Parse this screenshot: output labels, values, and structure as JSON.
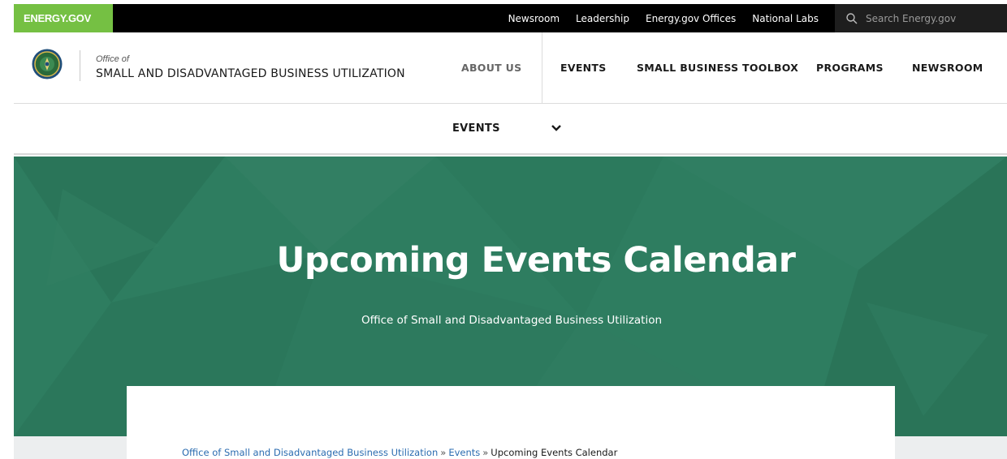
{
  "utility_bar": {
    "brand": "ENERGY.GOV",
    "links": [
      "Newsroom",
      "Leadership",
      "Energy.gov Offices",
      "National Labs"
    ],
    "search_placeholder": "Search Energy.gov"
  },
  "header": {
    "office_of": "Office of",
    "office_name": "SMALL AND DISADVANTAGED BUSINESS UTILIZATION",
    "nav": {
      "about": "ABOUT US",
      "events": "EVENTS",
      "toolbox": "SMALL BUSINESS TOOLBOX",
      "programs": "PROGRAMS",
      "newsroom": "NEWSROOM"
    }
  },
  "sub_nav": {
    "label": "EVENTS",
    "icon": "chevron-down-icon"
  },
  "hero": {
    "title": "Upcoming Events Calendar",
    "subtitle": "Office of Small and Disadvantaged Business Utilization"
  },
  "breadcrumb": {
    "items": [
      "Office of Small and Disadvantaged Business Utilization",
      "Events"
    ],
    "separator": "»",
    "current": "Upcoming Events Calendar"
  },
  "colors": {
    "brand_green": "#75c043",
    "hero_green": "#2e7d60",
    "link_blue": "#2b6cb0",
    "utility_black": "#000000"
  }
}
